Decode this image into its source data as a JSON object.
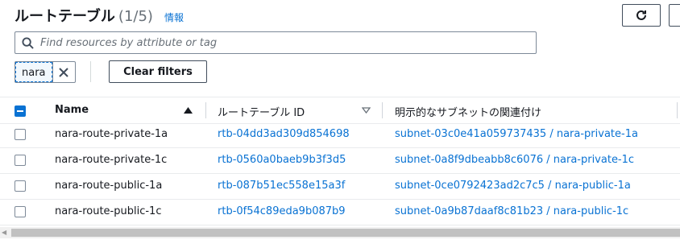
{
  "header": {
    "title": "ルートテーブル",
    "count": "(1/5)",
    "info_link": "情報"
  },
  "search": {
    "placeholder": "Find resources by attribute or tag",
    "value": ""
  },
  "filter": {
    "token_label": "nara",
    "clear_label": "Clear filters"
  },
  "table": {
    "columns": [
      "Name",
      "ルートテーブル ID",
      "明示的なサブネットの関連付け"
    ],
    "rows": [
      {
        "name": "nara-route-private-1a",
        "id": "rtb-04dd3ad309d854698",
        "subnet": "subnet-03c0e41a059737435 / nara-private-1a"
      },
      {
        "name": "nara-route-private-1c",
        "id": "rtb-0560a0baeb9b3f3d5",
        "subnet": "subnet-0a8f9dbeabb8c6076 / nara-private-1c"
      },
      {
        "name": "nara-route-public-1a",
        "id": "rtb-087b51ec558e15a3f",
        "subnet": "subnet-0ce0792423ad2c7c5 / nara-public-1a"
      },
      {
        "name": "nara-route-public-1c",
        "id": "rtb-0f54c89eda9b087b9",
        "subnet": "subnet-0a9b87daaf8c81b23 / nara-public-1c"
      }
    ]
  },
  "colors": {
    "link": "#0972d3",
    "text": "#16191f",
    "muted": "#687078",
    "border": "#7d8998"
  },
  "icons": {
    "refresh": "refresh-icon",
    "search": "search-icon",
    "close": "close-icon",
    "sort_asc": "caret-up-icon",
    "sort_desc": "caret-down-outline-icon"
  }
}
